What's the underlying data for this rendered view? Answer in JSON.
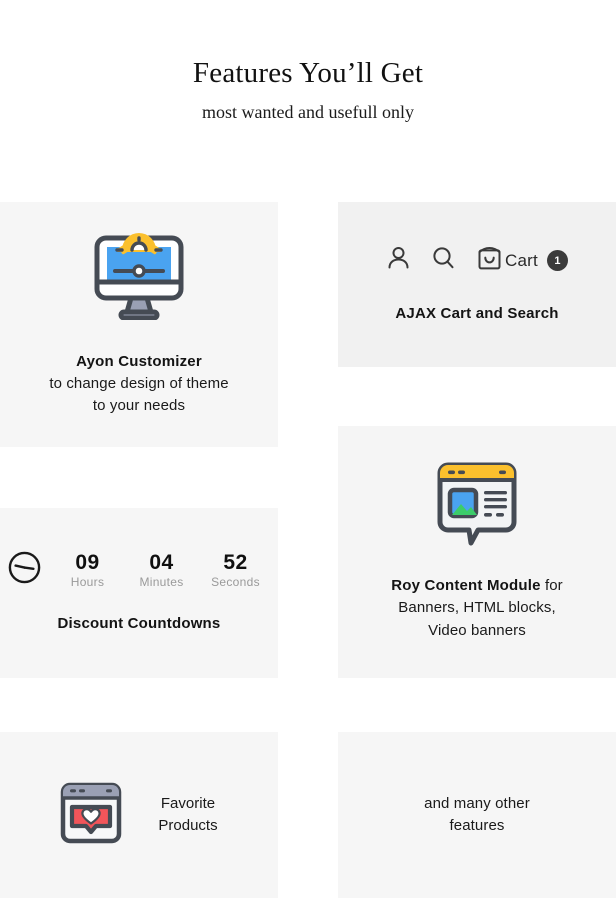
{
  "header": {
    "title": "Features You’ll Get",
    "subtitle": "most wanted and usefull only"
  },
  "cards": {
    "customizer": {
      "icon": "monitor-gear-icon",
      "title": "Ayon Customizer",
      "line1": "to change design of theme",
      "line2": "to your needs"
    },
    "ajax_cart": {
      "account_icon": "user-account-icon",
      "search_icon": "search-icon",
      "bag_icon": "shopping-bag-icon",
      "cart_label": "Cart",
      "cart_count": "1",
      "title": "AJAX Cart and Search"
    },
    "countdown": {
      "clock_icon": "clock-icon",
      "units": [
        {
          "value": "09",
          "label": "Hours"
        },
        {
          "value": "04",
          "label": "Minutes"
        },
        {
          "value": "52",
          "label": "Seconds"
        }
      ],
      "title": "Discount Countdowns"
    },
    "content_module": {
      "icon": "content-window-icon",
      "title": "Roy Content Module",
      "after_title": " for",
      "line2": "Banners, HTML blocks,",
      "line3": "Video banners"
    },
    "favorite": {
      "icon": "favorite-heart-window-icon",
      "line1": "Favorite",
      "line2": "Products"
    },
    "more": {
      "line1": "and many other",
      "line2": "features"
    }
  },
  "colors": {
    "page_background": "#ffffff",
    "card_background": "#f6f6f6",
    "card_background_alt": "#f1f1f1",
    "icon_outline": "#454b54",
    "icon_blue": "#4aa3f0",
    "icon_yellow": "#fbc02d",
    "icon_green": "#3ccd6a",
    "icon_red": "#f2555a",
    "icon_grey": "#9aa0b4",
    "badge_dark": "#3b3b3b",
    "muted_text": "#9a9a9a"
  }
}
